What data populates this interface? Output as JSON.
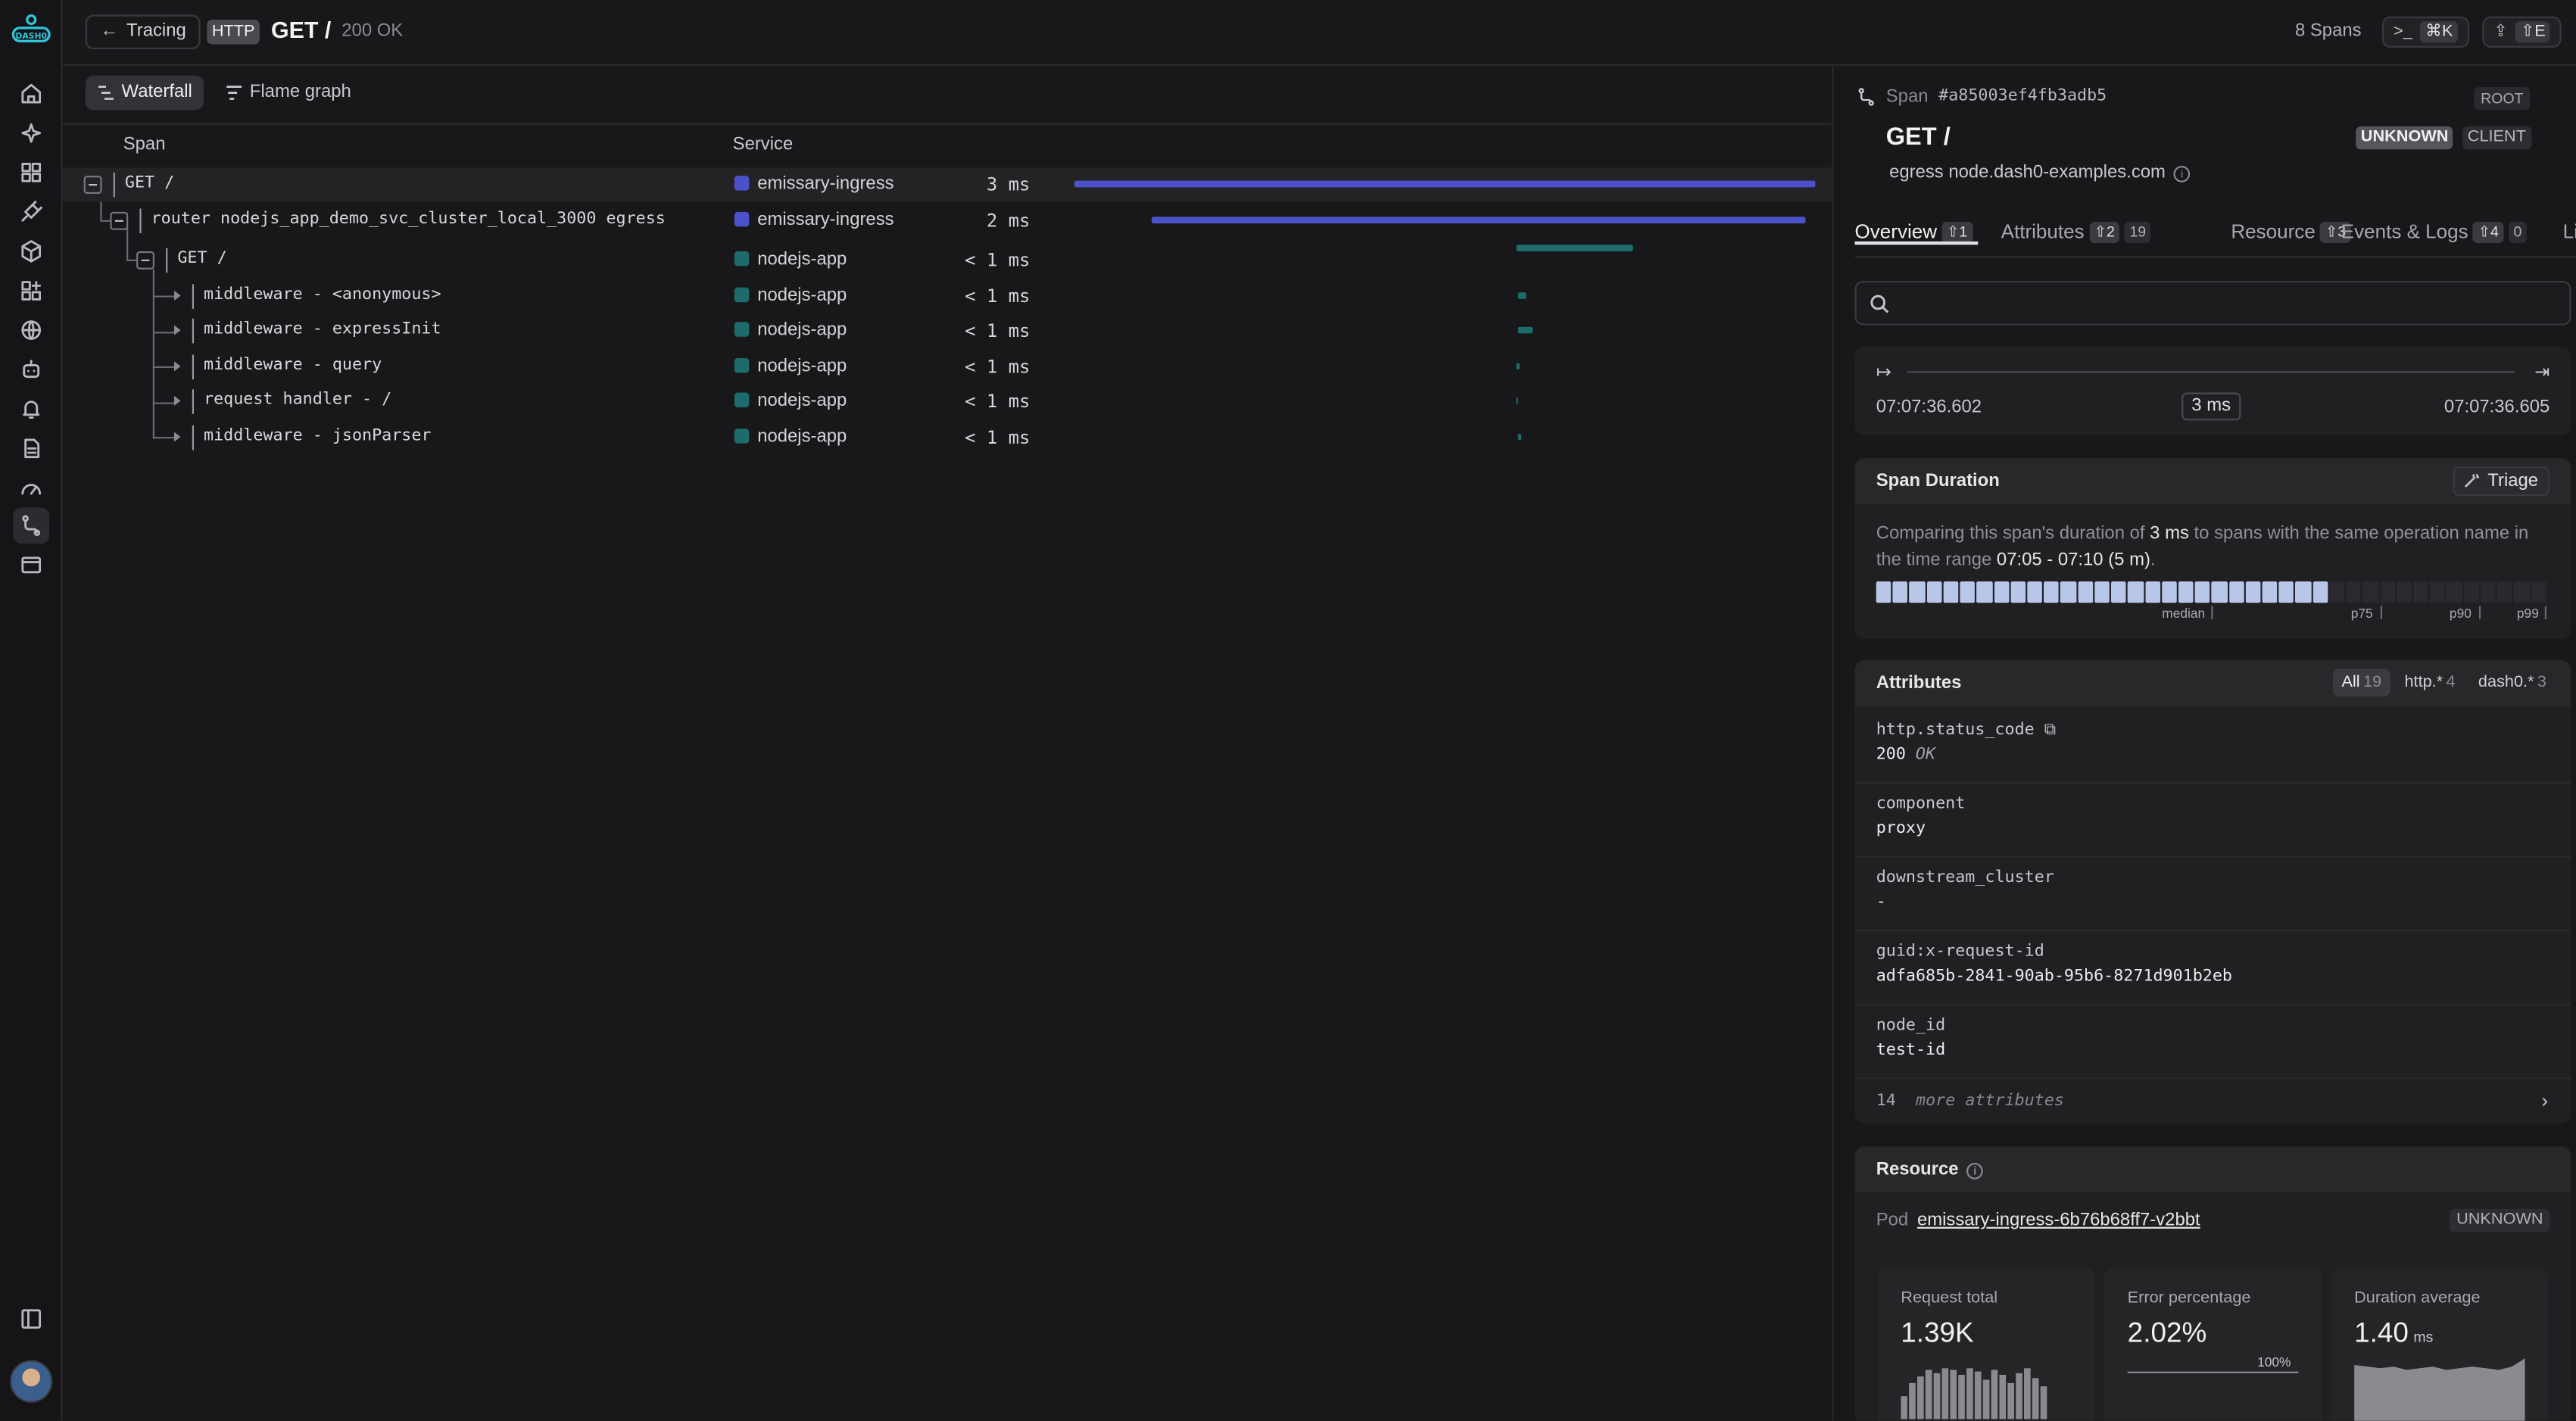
{
  "nav": {
    "logo_text": "DASH0",
    "items": [
      "home-icon",
      "sparkle-icon",
      "dashboards-icon",
      "plug-icon",
      "cube-icon",
      "widgets-icon",
      "globe-icon",
      "bot-icon",
      "bell-icon",
      "logs-icon",
      "gauge-icon",
      "tracing-icon",
      "window-icon"
    ],
    "active": "tracing-icon",
    "bottom": [
      "sidebar-toggle-icon"
    ]
  },
  "topbar": {
    "back_label": "Tracing",
    "method_badge": "HTTP",
    "title": "GET /",
    "status": "200 OK",
    "span_count": "8 Spans",
    "cmd_label": ">_",
    "cmd_kbd": "⌘K",
    "share_kbd": "⇧E"
  },
  "waterfall": {
    "view_tabs": [
      "Waterfall",
      "Flame graph"
    ],
    "active_view": "Waterfall",
    "col_span": "Span",
    "col_service": "Service",
    "rows": [
      {
        "name": "GET /",
        "service": "emissary-ingress",
        "duration": "3 ms",
        "color": "#4b52c9"
      },
      {
        "name": "router nodejs_app_demo_svc_cluster_local_3000 egress",
        "service": "emissary-ingress",
        "duration": "2 ms",
        "color": "#4b52c9"
      },
      {
        "name": "GET /",
        "service": "nodejs-app",
        "duration": "< 1 ms",
        "color": "#1d6b6b"
      },
      {
        "name": "middleware - <anonymous>",
        "service": "nodejs-app",
        "duration": "< 1 ms",
        "color": "#1d6b6b"
      },
      {
        "name": "middleware - expressInit",
        "service": "nodejs-app",
        "duration": "< 1 ms",
        "color": "#1d6b6b"
      },
      {
        "name": "middleware - query",
        "service": "nodejs-app",
        "duration": "< 1 ms",
        "color": "#1d6b6b"
      },
      {
        "name": "request handler - /",
        "service": "nodejs-app",
        "duration": "< 1 ms",
        "color": "#1d6b6b"
      },
      {
        "name": "middleware - jsonParser",
        "service": "nodejs-app",
        "duration": "< 1 ms",
        "color": "#1d6b6b"
      }
    ]
  },
  "detail": {
    "span_label": "Span",
    "span_id": "#a85003ef4fb3adb5",
    "root_badge": "ROOT",
    "title": "GET /",
    "kind_badge": "UNKNOWN",
    "client_badge": "CLIENT",
    "egress": "egress node.dash0-examples.com",
    "tabs": [
      {
        "label": "Overview",
        "count": "1",
        "extra": ""
      },
      {
        "label": "Attributes",
        "count": "2",
        "extra": "19"
      },
      {
        "label": "Resource",
        "count": "3",
        "extra": ""
      },
      {
        "label": "Events & Logs",
        "count": "4",
        "extra": "0"
      },
      {
        "label": "Li",
        "count": "",
        "extra": ""
      }
    ],
    "count_icon": "⇧",
    "search_placeholder": "",
    "time": {
      "start": "07:07:36.602",
      "end": "07:07:36.605",
      "duration": "3 ms"
    },
    "span_duration": {
      "title": "Span Duration",
      "triage_label": "Triage",
      "text_before": "Comparing this span's duration of ",
      "text_duration": "3 ms",
      "text_middle": " to spans with the same operation name in the time range ",
      "text_range": "07:05 - 07:10 (5 m)",
      "text_after": ".",
      "labels": {
        "median": "median",
        "p75": "p75",
        "p90": "p90",
        "p99": "p99"
      },
      "filled_fraction": 0.675
    },
    "attributes": {
      "title": "Attributes",
      "filters": [
        {
          "label": "All",
          "count": "19"
        },
        {
          "label": "http.*",
          "count": "4"
        },
        {
          "label": "dash0.*",
          "count": "3"
        }
      ],
      "items": [
        {
          "key": "http.status_code",
          "value": "200",
          "hint": "OK"
        },
        {
          "key": "component",
          "value": "proxy",
          "hint": ""
        },
        {
          "key": "downstream_cluster",
          "value": "-",
          "hint": ""
        },
        {
          "key": "guid:x-request-id",
          "value": "adfa685b-2841-90ab-95b6-8271d901b2eb",
          "hint": ""
        },
        {
          "key": "node_id",
          "value": "test-id",
          "hint": ""
        }
      ],
      "more_count": "14",
      "more_label": "more attributes"
    },
    "resource": {
      "title": "Resource",
      "pod_label": "Pod",
      "pod_value": "emissary-ingress-6b76b68ff7-v2bbt",
      "pod_badge": "UNKNOWN",
      "metrics": [
        {
          "label": "Request total",
          "value": "1.39K",
          "unit": ""
        },
        {
          "label": "Error percentage",
          "value": "2.02%",
          "unit": "",
          "scale_max": "100%"
        },
        {
          "label": "Duration average",
          "value": "1.40",
          "unit": "ms"
        }
      ]
    }
  }
}
